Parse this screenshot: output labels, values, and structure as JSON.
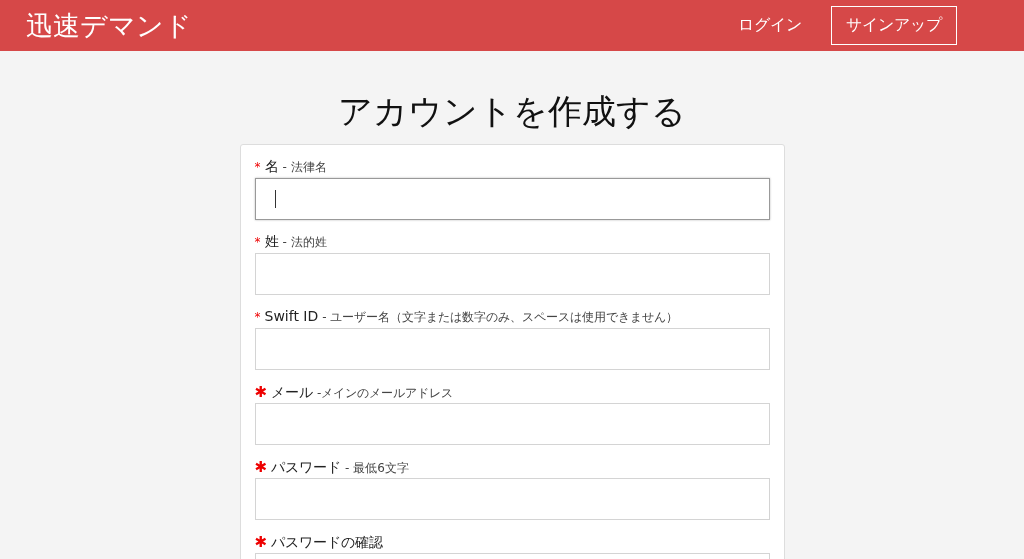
{
  "header": {
    "brand": "迅速デマンド",
    "nav": [
      {
        "label": "ログイン",
        "kind": "link"
      },
      {
        "label": "サインアップ",
        "kind": "outlined"
      }
    ]
  },
  "title": "アカウントを作成する",
  "fields": [
    {
      "marker": "*",
      "kind": "asterisk",
      "label": "名",
      "hint": "- 法律名",
      "focused": true
    },
    {
      "marker": "*",
      "kind": "asterisk",
      "label": "姓",
      "hint": "- 法的姓",
      "focused": false
    },
    {
      "marker": "*",
      "kind": "asterisk",
      "label": "Swift ID",
      "hint": "- ユーザー名（文字または数字のみ、スペースは使用できません）",
      "focused": false
    },
    {
      "marker": "✱",
      "kind": "star",
      "label": "メール",
      "hint": "-メインのメールアドレス",
      "focused": false
    },
    {
      "marker": "✱",
      "kind": "star",
      "label": "パスワード",
      "hint": "- 最低6文字",
      "focused": false
    },
    {
      "marker": "✱",
      "kind": "star",
      "label": "パスワードの確認",
      "focused": false
    }
  ]
}
